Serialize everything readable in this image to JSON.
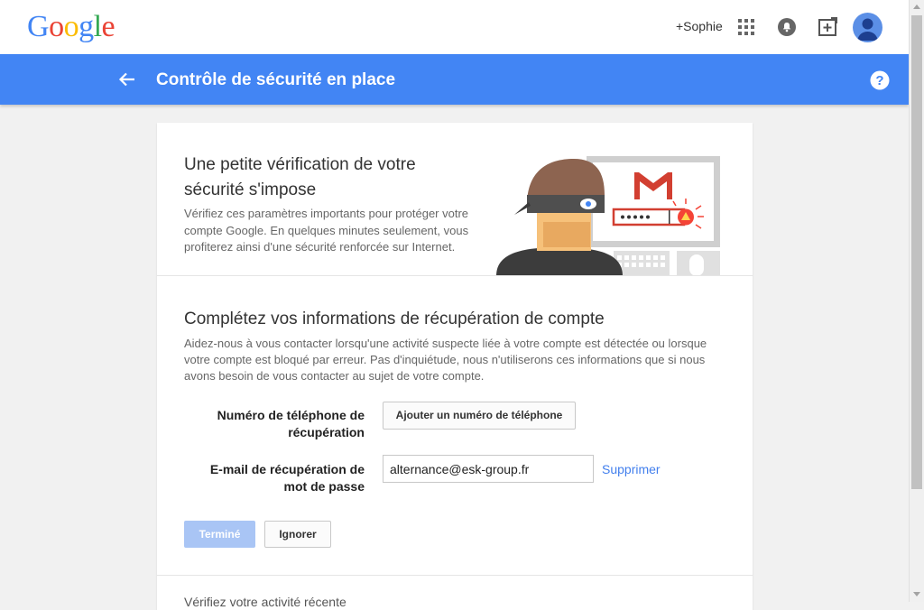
{
  "header": {
    "logo_text": "Google",
    "user_link": "+Sophie",
    "icons": [
      "apps-icon",
      "notifications-icon",
      "share-icon",
      "avatar"
    ]
  },
  "appbar": {
    "title": "Contrôle de sécurité en place",
    "back_icon": "arrow-left-icon",
    "help_icon": "help-icon"
  },
  "hero": {
    "title": "Une petite vérification de votre sécurité s'impose",
    "description": "Vérifiez ces paramètres importants pour protéger votre compte Google. En quelques minutes seulement, vous profiterez ainsi d'une sécurité renforcée sur Internet.",
    "illustration": "masked-thief-computer-illustration"
  },
  "recovery": {
    "title": "Complétez vos informations de récupération de compte",
    "description": "Aidez-nous à vous contacter lorsqu'une activité suspecte liée à votre compte est détectée ou lorsque votre compte est bloqué par erreur. Pas d'inquiétude, nous n'utiliserons ces informations que si nous avons besoin de vous contacter au sujet de votre compte.",
    "phone_label": "Numéro de téléphone de récupération",
    "phone_button": "Ajouter un numéro de téléphone",
    "email_label": "E-mail de récupération de mot de passe",
    "email_value": "alternance@esk-group.fr",
    "remove_link": "Supprimer",
    "done_button": "Terminé",
    "ignore_button": "Ignorer"
  },
  "next_section": {
    "title": "Vérifiez votre activité récente"
  },
  "colors": {
    "brand_blue": "#4285f4",
    "link_blue": "#427fed",
    "disabled_button": "#a9c5f5",
    "background": "#f1f1f1"
  }
}
